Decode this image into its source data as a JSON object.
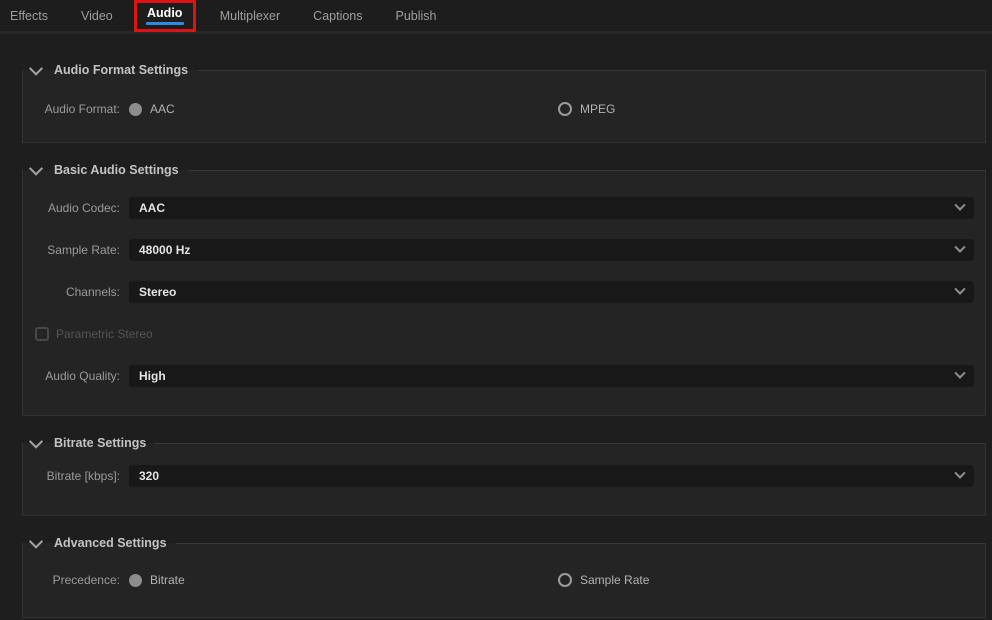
{
  "colors": {
    "accent_blue": "#2f8ae0",
    "annotation_red": "#dd1414",
    "panel_background": "#1e1e1e",
    "section_background": "#242424",
    "dropdown_background": "#181818"
  },
  "tab_bar": {
    "tabs": [
      {
        "label": "Effects",
        "active": false
      },
      {
        "label": "Video",
        "active": false
      },
      {
        "label": "Audio",
        "active": true,
        "annotated_with_red_box": true
      },
      {
        "label": "Multiplexer",
        "active": false
      },
      {
        "label": "Captions",
        "active": false
      },
      {
        "label": "Publish",
        "active": false
      }
    ]
  },
  "audio_format_settings": {
    "title": "Audio Format Settings",
    "collapsed": false,
    "audio_format": {
      "label": "Audio Format:",
      "options": [
        {
          "label": "AAC",
          "selected": true,
          "enabled": false
        },
        {
          "label": "MPEG",
          "selected": false,
          "enabled": true
        }
      ]
    }
  },
  "basic_audio_settings": {
    "title": "Basic Audio Settings",
    "collapsed": false,
    "audio_codec": {
      "label": "Audio Codec:",
      "value": "AAC"
    },
    "sample_rate": {
      "label": "Sample Rate:",
      "value": "48000 Hz"
    },
    "channels": {
      "label": "Channels:",
      "value": "Stereo"
    },
    "parametric_stereo": {
      "label": "Parametric Stereo",
      "checked": false,
      "enabled": false
    },
    "audio_quality": {
      "label": "Audio Quality:",
      "value": "High"
    }
  },
  "bitrate_settings": {
    "title": "Bitrate Settings",
    "collapsed": false,
    "bitrate": {
      "label": "Bitrate [kbps]:",
      "value": "320"
    }
  },
  "advanced_settings": {
    "title": "Advanced Settings",
    "collapsed": false,
    "precedence": {
      "label": "Precedence:",
      "options": [
        {
          "label": "Bitrate",
          "selected": true,
          "enabled": false
        },
        {
          "label": "Sample Rate",
          "selected": false,
          "enabled": true
        }
      ]
    }
  }
}
